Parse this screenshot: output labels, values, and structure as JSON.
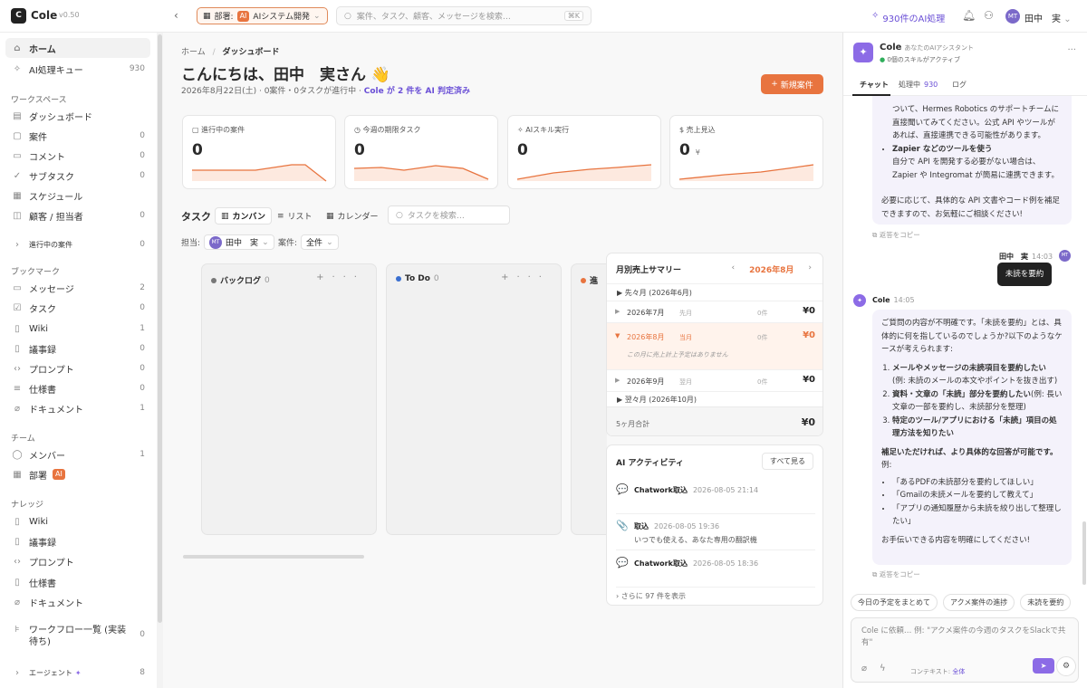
{
  "header": {
    "logo_text": "C",
    "app_name": "Cole",
    "version": "v0.50",
    "dept_label": "部署:",
    "dept_badge": "AI",
    "dept_value": "AIシステム開発",
    "search_placeholder": "案件、タスク、顧客、メッセージを検索…",
    "search_shortcut": "⌘K",
    "ai_queue": "930件のAI処理",
    "user_initials": "MT",
    "user_name": "田中　実"
  },
  "sidebar": {
    "top": [
      {
        "icon": "⌂",
        "label": "ホーム",
        "count": ""
      },
      {
        "icon": "✧",
        "label": "AI処理キュー",
        "count": "930"
      }
    ],
    "workspace_title": "ワークスペース",
    "workspace": [
      {
        "icon": "▤",
        "label": "ダッシュボード",
        "count": ""
      },
      {
        "icon": "▢",
        "label": "案件",
        "count": "0"
      },
      {
        "icon": "▭",
        "label": "コメント",
        "count": "0"
      },
      {
        "icon": "✓",
        "label": "サブタスク",
        "count": "0"
      },
      {
        "icon": "▦",
        "label": "スケジュール",
        "count": ""
      },
      {
        "icon": "◫",
        "label": "顧客 / 担当者",
        "count": "0"
      }
    ],
    "active_cases": {
      "label": "進行中の案件",
      "count": "0"
    },
    "bookmark_title": "ブックマーク",
    "bookmarks": [
      {
        "icon": "▭",
        "label": "メッセージ",
        "count": "2"
      },
      {
        "icon": "☑",
        "label": "タスク",
        "count": "0"
      },
      {
        "icon": "▯",
        "label": "Wiki",
        "count": "1"
      },
      {
        "icon": "▯",
        "label": "議事録",
        "count": "0"
      },
      {
        "icon": "‹›",
        "label": "プロンプト",
        "count": "0"
      },
      {
        "icon": "≡",
        "label": "仕様書",
        "count": "0"
      },
      {
        "icon": "⌀",
        "label": "ドキュメント",
        "count": "1"
      }
    ],
    "team_title": "チーム",
    "team": [
      {
        "icon": "◯",
        "label": "メンバー",
        "count": "1"
      },
      {
        "icon": "▦",
        "label": "部署",
        "badge": "AI"
      }
    ],
    "knowledge_title": "ナレッジ",
    "knowledge": [
      {
        "icon": "▯",
        "label": "Wiki"
      },
      {
        "icon": "▯",
        "label": "議事録"
      },
      {
        "icon": "‹›",
        "label": "プロンプト"
      },
      {
        "icon": "▯",
        "label": "仕様書"
      },
      {
        "icon": "⌀",
        "label": "ドキュメント"
      }
    ],
    "workflow": {
      "label": "ワークフロー一覧 (実装待ち)",
      "count": "0"
    },
    "agent": {
      "label": "エージェント",
      "count": "8"
    }
  },
  "main": {
    "breadcrumb_home": "ホーム",
    "breadcrumb_current": "ダッシュボード",
    "greeting": "こんにちは、田中　実さん 👋",
    "subline": "2026年8月22日(土) · 0案件・0タスクが進行中 ·",
    "subline_link": "Cole が 2 件を AI 判定済み",
    "new_button": "新規案件",
    "cards": [
      {
        "icon": "▢",
        "label": "進行中の案件",
        "value": "0",
        "unit": ""
      },
      {
        "icon": "◷",
        "label": "今週の期限タスク",
        "value": "0",
        "unit": ""
      },
      {
        "icon": "✧",
        "label": "AIスキル実行",
        "value": "0",
        "unit": ""
      },
      {
        "icon": "$",
        "label": "売上見込",
        "value": "0",
        "unit": "¥"
      }
    ],
    "tasks_title": "タスク",
    "view_tabs": [
      "カンバン",
      "リスト",
      "カレンダー"
    ],
    "task_search_placeholder": "タスクを検索…",
    "filter_assignee_label": "担当:",
    "filter_assignee": "田中　実",
    "filter_case_label": "案件:",
    "filter_case": "全件",
    "kanban": [
      {
        "title": "バックログ",
        "count": "0",
        "color": "#777777"
      },
      {
        "title": "To Do",
        "count": "0",
        "color": "#3a6fd0"
      },
      {
        "title": "進",
        "count": "",
        "color": "#e8743f"
      }
    ]
  },
  "sales": {
    "title": "月別売上サマリー",
    "month": "2026年8月",
    "prev_prev": "▶ 先々月 (2026年6月)",
    "rows": [
      {
        "month": "2026年7月",
        "tag": "先月",
        "count": "0件",
        "amount": "¥0"
      },
      {
        "month": "2026年8月",
        "tag": "当月",
        "count": "0件",
        "amount": "¥0",
        "note": "この月に売上計上予定はありません"
      },
      {
        "month": "2026年9月",
        "tag": "翌月",
        "count": "0件",
        "amount": "¥0"
      }
    ],
    "next_next": "▶ 翌々月 (2026年10月)",
    "total_label": "5ヶ月合計",
    "total": "¥0"
  },
  "activity": {
    "title": "AI アクティビティ",
    "see_all": "すべて見る",
    "items": [
      {
        "icon": "💬",
        "title": "Chatwork取込",
        "time": "2026-08-05 21:14",
        "desc": ""
      },
      {
        "icon": "📎",
        "title": "取込",
        "time": "2026-08-05 19:36",
        "desc": "いつでも使える、あなた専用の翻訳機"
      },
      {
        "icon": "💬",
        "title": "Chatwork取込",
        "time": "2026-08-05 18:36",
        "desc": ""
      }
    ],
    "more": "さらに 97 件を表示"
  },
  "chat": {
    "name": "Cole",
    "subtitle": "あなたのAIアシスタント",
    "skills": "0個のスキルがアクティブ",
    "tabs": [
      {
        "label": "チャット",
        "count": ""
      },
      {
        "label": "処理中",
        "count": "930"
      },
      {
        "label": "ログ",
        "count": ""
      }
    ],
    "msg1_lead": "ついて、Hermes Robotics のサポートチームに直接聞いてみてください。公式 API やツールがあれば、直接連携できる可能性があります。",
    "msg1_bullet_title": "Zapier などのツールを使う",
    "msg1_bullet_text": "自分で API を開発する必要がない場合は、Zapier や Integromat が簡易に連携できます。",
    "msg1_tail": "必要に応じて、具体的な API 文書やコード例を補足できますので、お気軽にご相談ください!",
    "copy_label": "返答をコピー",
    "user_name": "田中　実",
    "user_time": "14:03",
    "user_initials": "MT",
    "user_msg": "未読を要約",
    "bot_name": "Cole",
    "bot_time": "14:05",
    "msg2_intro": "ご質問の内容が不明確です。「未読を要約」とは、具体的に何を指しているのでしょうか?以下のようなケースが考えられます:",
    "msg2_items": [
      {
        "title": "メールやメッセージの未読項目を要約したい",
        "text": "(例: 未読のメールの本文やポイントを抜き出す)"
      },
      {
        "title": "資料・文章の「未読」部分を要約したい",
        "text": "(例: 長い文章の一部を要約し、未読部分を整理)"
      },
      {
        "title": "特定のツール/アプリにおける「未読」項目の処理方法を知りたい",
        "text": ""
      }
    ],
    "msg2_ask": "補足いただければ、より具体的な回答が可能です。",
    "msg2_ex": "例:",
    "msg2_examples": [
      "「あるPDFの未読部分を要約してほしい」",
      "「Gmailの未読メールを要約して教えて」",
      "「アプリの通知履歴から未読を絞り出して整理したい」"
    ],
    "msg2_tail": "お手伝いできる内容を明確にしてください!",
    "suggestions": [
      "今日の予定をまとめて",
      "アクメ案件の進捗",
      "未読を要約"
    ],
    "input_placeholder": "Cole に依頼… 例: \"アクメ案件の今週のタスクをSlackで共有\"",
    "context_label": "コンテキスト:",
    "context_value": "全体"
  }
}
